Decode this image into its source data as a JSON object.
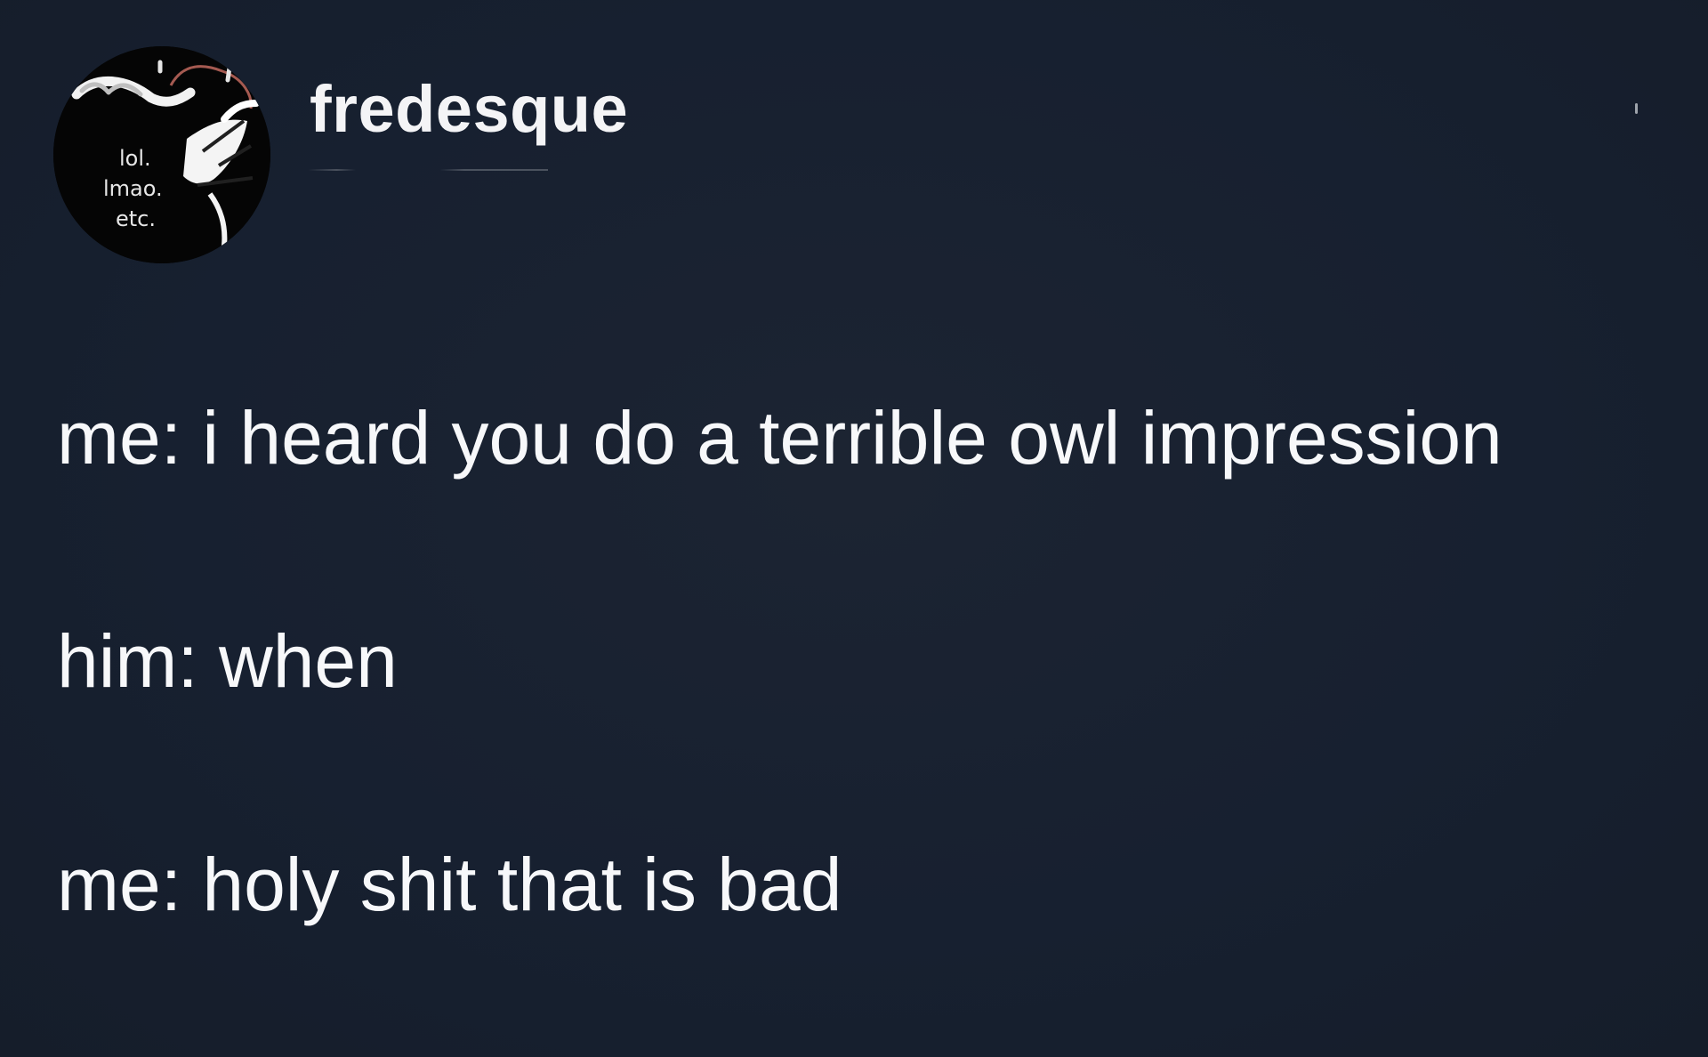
{
  "post": {
    "username": "fredesque",
    "avatar_text": [
      "lol.",
      "lmao.",
      "etc."
    ],
    "lines": [
      "me: i heard you do a terrible owl impression",
      "him: when",
      "me: holy shit that is bad"
    ]
  },
  "colors": {
    "background": "#18202d",
    "text": "#f7f8fa"
  },
  "icons": {
    "menu": "more-options-icon"
  }
}
